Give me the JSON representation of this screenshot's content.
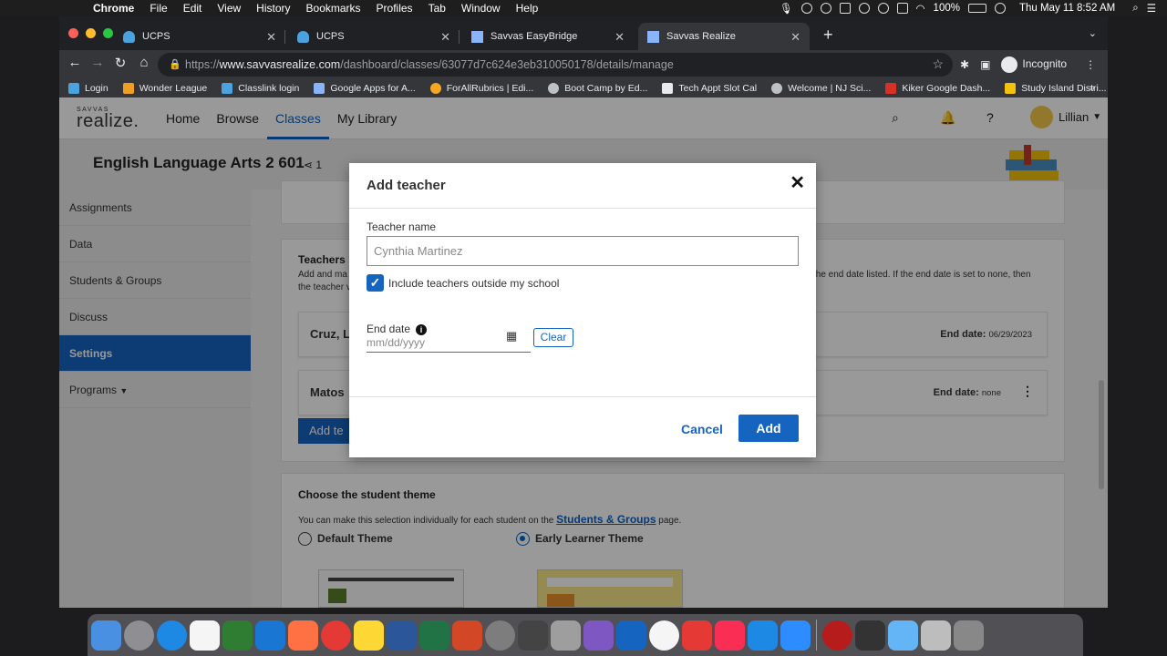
{
  "menubar": {
    "app": "Chrome",
    "items": [
      "File",
      "Edit",
      "View",
      "History",
      "Bookmarks",
      "Profiles",
      "Tab",
      "Window",
      "Help"
    ],
    "battery": "100%",
    "clock": "Thu May 11  8:52 AM"
  },
  "tabs": [
    {
      "title": "UCPS",
      "icon_color": "#4aa3df"
    },
    {
      "title": "UCPS",
      "icon_color": "#4aa3df"
    },
    {
      "title": "Savvas EasyBridge",
      "icon_color": "#8ab4f8"
    },
    {
      "title": "Savvas Realize",
      "icon_color": "#8ab4f8"
    }
  ],
  "address": {
    "scheme": "https://",
    "host": "www.savvasrealize.com",
    "path": "/dashboard/classes/63077d7c624e3eb310050178/details/manage"
  },
  "incognito_label": "Incognito",
  "bookmarks": [
    {
      "label": "Login",
      "color": "#4aa3df"
    },
    {
      "label": "Wonder League",
      "color": "#f0a020"
    },
    {
      "label": "Classlink login",
      "color": "#4aa3df"
    },
    {
      "label": "Google Apps for A...",
      "color": "#8ab4f8"
    },
    {
      "label": "ForAllRubrics | Edi...",
      "color": "#f5a623"
    },
    {
      "label": "Boot Camp by Ed...",
      "color": "#bdc1c6"
    },
    {
      "label": "Tech Appt Slot Cal",
      "color": "#e8eaed"
    },
    {
      "label": "Welcome | NJ Sci...",
      "color": "#bdc1c6"
    },
    {
      "label": "Kiker Google Dash...",
      "color": "#d93025"
    },
    {
      "label": "Study Island Distri...",
      "color": "#f4c20d"
    }
  ],
  "site": {
    "logo_small": "SAVVAS",
    "logo_main": "realize.",
    "nav": [
      "Home",
      "Browse",
      "Classes",
      "My Library"
    ],
    "active_nav": "Classes",
    "user": "Lillian"
  },
  "class": {
    "title": "English Language Arts 2 601",
    "share_count": "1"
  },
  "sidenav": [
    "Assignments",
    "Data",
    "Students & Groups",
    "Discuss",
    "Settings",
    "Programs"
  ],
  "sidenav_active": "Settings",
  "teachers": {
    "title": "Teachers",
    "desc_left_1": "Add and ma",
    "desc_left_2": "the teacher v",
    "desc_right": "the end date listed. If the end date is set to none, then",
    "rows": [
      {
        "name": "Cruz, Li",
        "end_label": "End date:",
        "end_value": "06/29/2023"
      },
      {
        "name": "Matos",
        "end_label": "End date:",
        "end_value": "none"
      }
    ],
    "add_button": "Add te"
  },
  "theme": {
    "title": "Choose the student theme",
    "desc": "You can make this selection individually for each student on the",
    "link": "Students & Groups",
    "desc_end": "page.",
    "options": [
      {
        "label": "Default Theme",
        "selected": false
      },
      {
        "label": "Early Learner Theme",
        "selected": true
      }
    ]
  },
  "modal": {
    "title": "Add teacher",
    "teacher_name_label": "Teacher name",
    "teacher_name_placeholder": "Cynthia Martinez",
    "include_label": "Include teachers outside my school",
    "include_checked": true,
    "end_date_label": "End date",
    "end_date_placeholder": "mm/dd/yyyy",
    "clear": "Clear",
    "cancel": "Cancel",
    "add": "Add"
  },
  "dock_colors": [
    "#4a90e2",
    "#8e8e93",
    "#1e88e5",
    "#f5f5f5",
    "#2e7d32",
    "#1976d2",
    "#ff7043",
    "#e53935",
    "#fdd835",
    "#2b579a",
    "#217346",
    "#d24726",
    "#7d7d7d",
    "#444",
    "#9e9e9e",
    "#7e57c2",
    "#1565c0",
    "#f5f5f5",
    "#e53935",
    "#fa2d55",
    "#1e88e5",
    "#2d8cff",
    "#b71c1c",
    "#333",
    "#64b5f6",
    "#bdbdbd",
    "#888"
  ]
}
